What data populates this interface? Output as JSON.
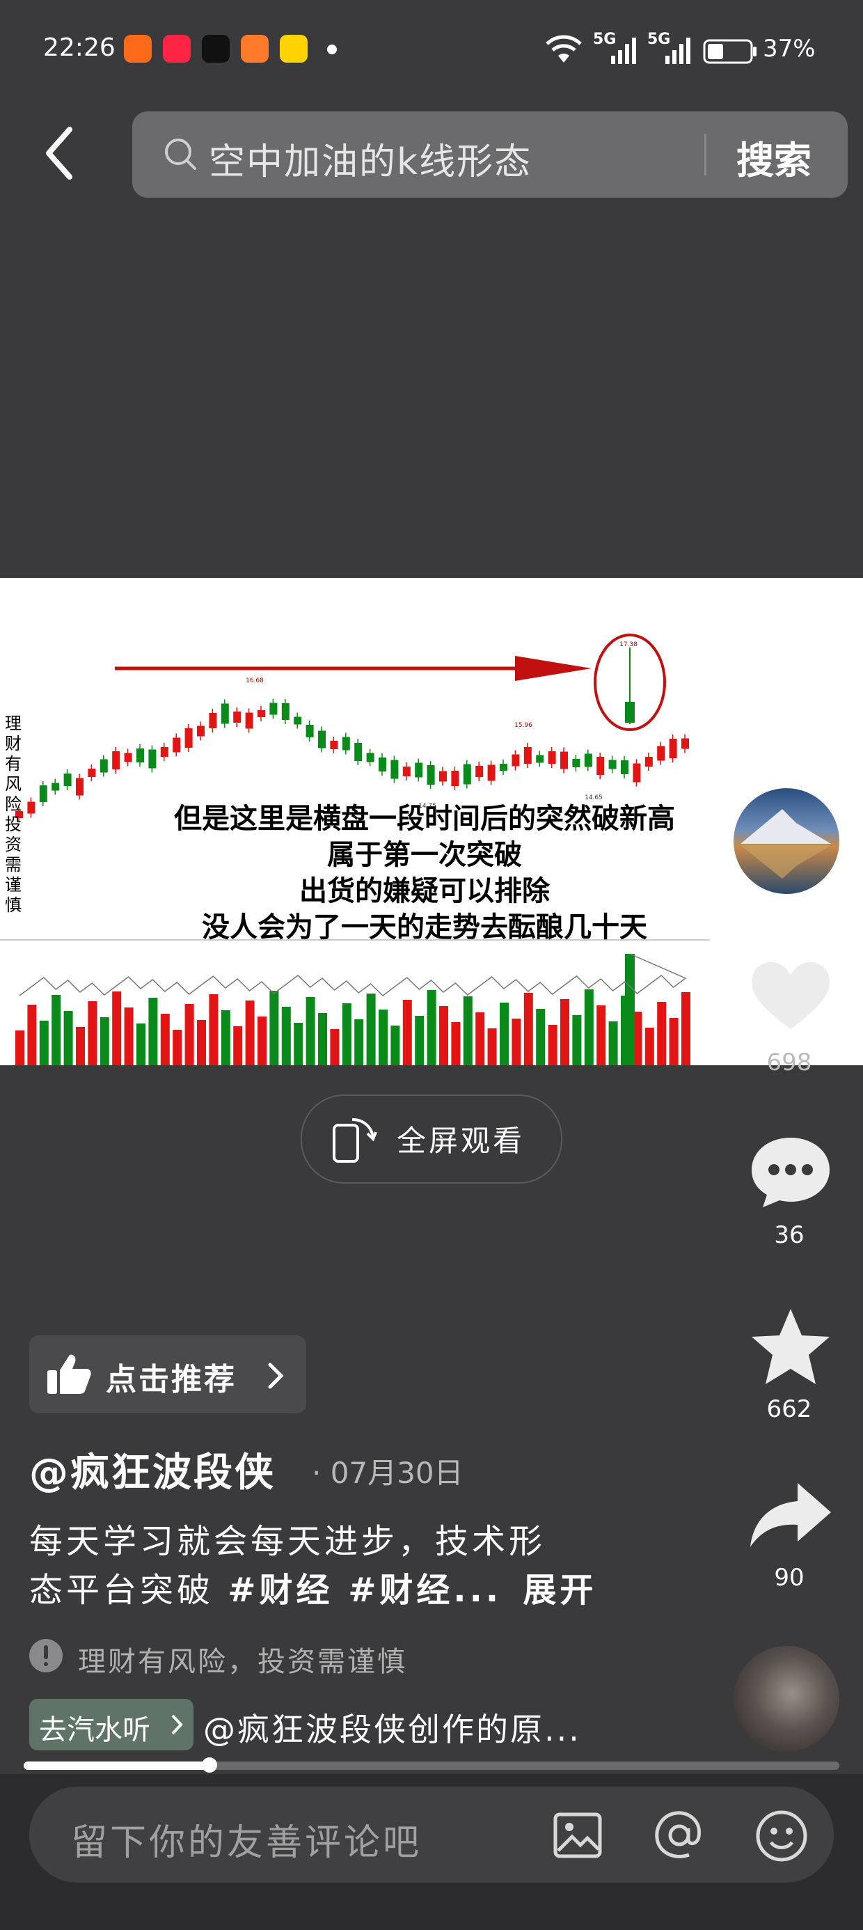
{
  "status_bar": {
    "time": "22:26",
    "network1": "5G",
    "network2": "5G",
    "battery": "37%",
    "app_icons": [
      "taobao-icon",
      "xiaohongshu-icon",
      "douyin-icon",
      "app-icon",
      "meituan-icon"
    ]
  },
  "search": {
    "query": "空中加油的k线形态",
    "button": "搜索"
  },
  "video": {
    "caption_lines": [
      "但是这里是横盘一段时间后的突然破新高",
      "属于第一次突破",
      "出货的嫌疑可以排除",
      "没人会为了一天的走势去酝酿几十天"
    ],
    "side_text": "理财有风险投资需谨慎",
    "chart_labels": {
      "p1": "16.68",
      "p2": "15.96",
      "p3": "14.75",
      "p4": "14.65",
      "p5": "17.38"
    }
  },
  "rail": {
    "like_count": "698",
    "comment_count": "36",
    "favorite_count": "662",
    "share_count": "90"
  },
  "fullscreen": {
    "label": "全屏观看"
  },
  "recommend": {
    "label": "点击推荐"
  },
  "post": {
    "author": "@疯狂波段侠",
    "date": "· 07月30日",
    "desc_line1": "每天学习就会每天进步，技术形",
    "desc_line2_plain": "态平台突破 ",
    "desc_line2_tags": "#财经 #财经...",
    "expand": "展开",
    "warning": "理财有风险，投资需谨慎",
    "music_tag": "去汽水听",
    "music_text": "@疯狂波段侠创作的原..."
  },
  "progress": {
    "fraction": 0.23
  },
  "comment": {
    "placeholder": "留下你的友善评论吧"
  },
  "colors": {
    "background": "#3a3a3c",
    "up_candle": "#e31414",
    "down_candle": "#0a8a1a",
    "arrow": "#c01010"
  }
}
